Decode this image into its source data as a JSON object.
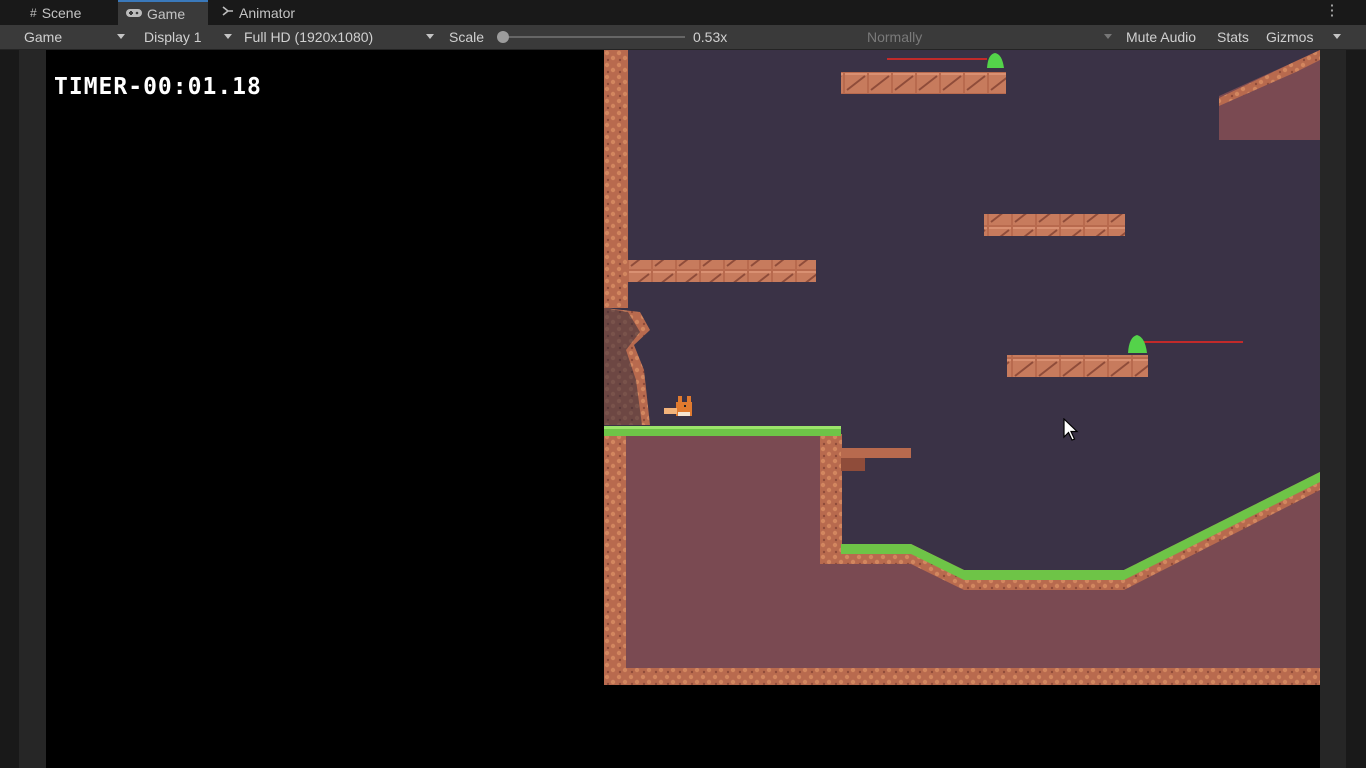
{
  "tabs": [
    {
      "label": "Scene",
      "icon": "grid-icon"
    },
    {
      "label": "Game",
      "icon": "gamepad-icon"
    },
    {
      "label": "Animator",
      "icon": "animator-icon"
    }
  ],
  "toolbar": {
    "view_mode": "Game",
    "display": "Display 1",
    "resolution": "Full HD (1920x1080)",
    "scale_label": "Scale",
    "scale_value": "0.53x",
    "play_mode": "Normally",
    "mute_audio": "Mute Audio",
    "stats": "Stats",
    "gizmos": "Gizmos"
  },
  "game": {
    "timer": "TIMER-00:01.18",
    "sky_color": "#3a3246",
    "dirt_color": "#7a4a52",
    "grass_color": "#6ec447",
    "brick_color": "#b86a4e"
  }
}
